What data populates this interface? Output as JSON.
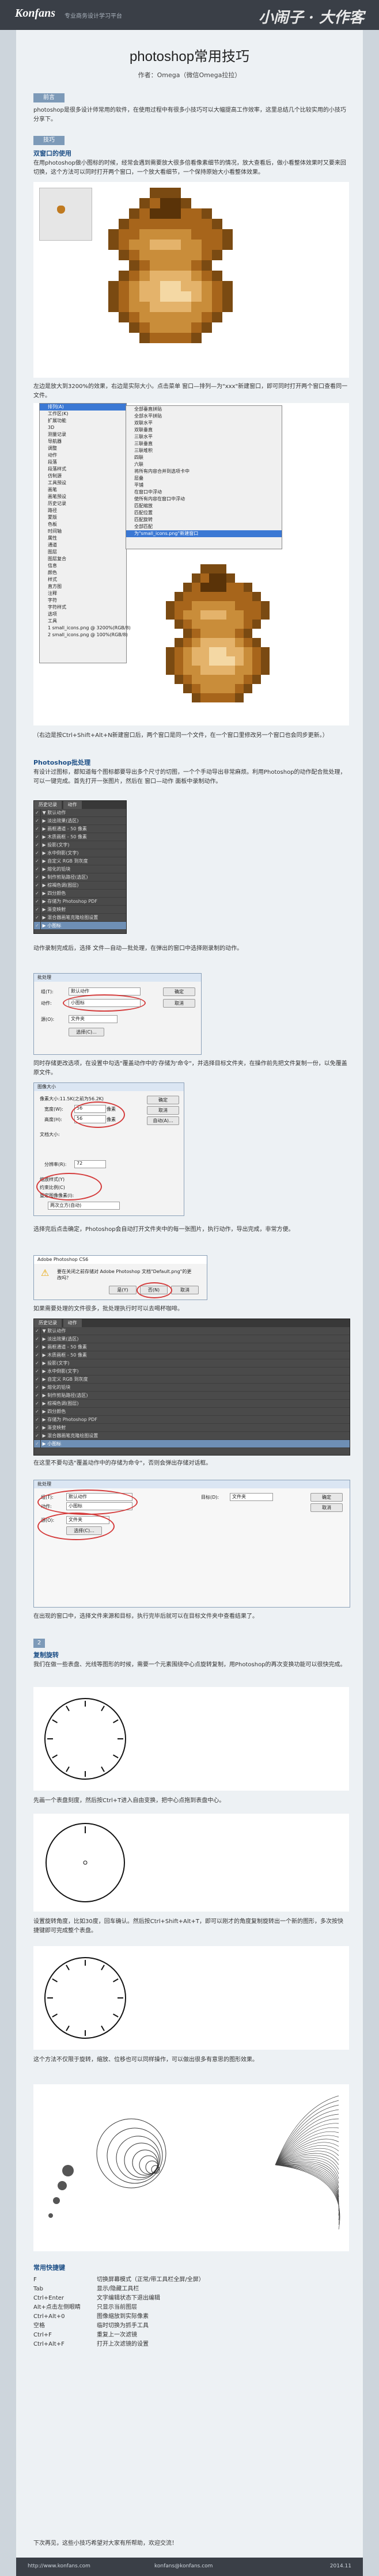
{
  "header": {
    "logo": "Konfans",
    "tagline": "专业商务设计学习平台",
    "signature": "小闹子 · 大作客"
  },
  "title": "photoshop常用技巧",
  "author": "作者：Omega（微信Omega拉拉）",
  "sections": {
    "intro_tag": "前言",
    "intro_text": "photoshop是很多设计师常用的软件，在使用过程中有很多小技巧可以大幅提高工作效率，这里总结几个比较实用的小技巧分享下。",
    "tips_tag": "技巧",
    "tip1_title": "1",
    "tip1_heading": "双窗口的使用",
    "tip1_text": "在用photoshop做小图标的时候，经常会遇到需要放大很多倍看像素细节的情况，放大查看后，做小看整体效果时又要来回切换，这个方法可以同时打开两个窗口，一个放大看细节，一个保持原始大小看整体效果。",
    "tip1_text2": "左边是放大到3200%的效果，右边是实际大小。点击菜单 窗口—排列—为\"xxx\"新建窗口，即可同时打开两个窗口查看同一文件。",
    "tip1_caption": "（右边是按Ctrl+Shift+Alt+N新建窗口后，两个窗口是同一个文件，在一个窗口里修改另一个窗口也会同步更新。）",
    "tip2_heading": "Photoshop批处理",
    "tip2_text": "有设计过图标，都知道每个图标都要导出多个尺寸的切图，一个个手动导出非常麻烦。利用Photoshop的动作配合批处理，可以一键完成。首先打开一张图片，然后在 窗口—动作 面板中录制动作。",
    "tip2_text2": "动作录制完成后，选择 文件—自动—批处理，在弹出的窗口中选择刚录制的动作。",
    "tip2_text3": "同时存储更改选项，在设置中勾选\"覆盖动作中的'存储为'命令\"，并选择目标文件夹，在操作前先把文件复制一份，以免覆盖原文件。",
    "tip2_text4": "选择完后点击确定，Photoshop会自动打开文件夹中的每一张图片，执行动作，导出完成，非常方便。",
    "tip2_text5": "如果需要处理的文件很多，批处理执行时可以去喝杯咖啡。",
    "tip2_text6": "在这里不要勾选\"覆盖动作中的存储为命令\"，否则会弹出存储对话框。",
    "tip2_text7": "在出现的窗口中，选择文件来源和目标，执行完毕后就可以在目标文件夹中查看结果了。",
    "tip3_title": "2",
    "tip3_heading": "复制旋转",
    "tip3_text": "我们在做一些表盘、光线等图形的时候，需要一个元素围绕中心点旋转复制，用Photoshop的再次变换功能可以很快完成。",
    "tip3_text2": "先画一个表盘刻度，然后按Ctrl+T进入自由变换，把中心点拖到表盘中心。",
    "tip3_text3": "设置旋转角度，比如30度，回车确认。然后按Ctrl+Shift+Alt+T，即可以刚才的角度复制旋转出一个新的图形，多次按快捷键即可完成整个表盘。",
    "tip3_text4": "这个方法不仅限于旋转，缩放、位移也可以同样操作，可以做出很多有意思的图形效果。",
    "shortcut_heading": "常用快捷键",
    "shortcuts": [
      [
        "F",
        "切换屏幕模式（正常/带工具栏全屏/全屏）"
      ],
      [
        "Tab",
        "显示/隐藏工具栏"
      ],
      [
        "Ctrl+Enter",
        "文字编辑状态下退出编辑"
      ],
      [
        "Alt+点击左侧眼睛",
        "只显示当前图层"
      ],
      [
        "Ctrl+Alt+0",
        "图像缩放到实际像素"
      ],
      [
        "空格",
        "临时切换为抓手工具"
      ],
      [
        "Ctrl+F",
        "重复上一次滤镜"
      ],
      [
        "Ctrl+Alt+F",
        "打开上次滤镜的设置"
      ]
    ],
    "closing": "下次再见，这些小技巧希望对大家有所帮助，欢迎交流！"
  },
  "menu": {
    "items_left": [
      "排列(A)",
      "工作区(K)",
      "扩展功能",
      "3D",
      "测量记录",
      "导航器",
      "调整",
      "动作",
      "段落",
      "段落样式",
      "仿制源",
      "工具预设",
      "画笔",
      "画笔预设",
      "历史记录",
      "路径",
      "蒙版",
      "色板",
      "时间轴",
      "属性",
      "通道",
      "图层",
      "图层复合",
      "信息",
      "颜色",
      "样式",
      "直方图",
      "注释",
      "字符",
      "字符样式",
      "选项",
      "工具",
      "1 small_icons.png @ 3200%(RGB/8)",
      "2 small_icons.png @ 100%(RGB/8)"
    ],
    "items_right": [
      "全部垂直拼贴",
      "全部水平拼贴",
      "双联水平",
      "双联垂直",
      "三联水平",
      "三联垂直",
      "三联堆积",
      "四联",
      "六联",
      "将所有内容合并到选项卡中",
      "层叠",
      "平铺",
      "在窗口中浮动",
      "使所有内容在窗口中浮动",
      "匹配缩放",
      "匹配位置",
      "匹配旋转",
      "全部匹配",
      "为\"small_icons.png\"新建窗口"
    ]
  },
  "actions_panel": {
    "tabs": [
      "历史记录",
      "动作"
    ],
    "rows": [
      "默认动作",
      "淡出效果(选区)",
      "画框通道 - 50 像素",
      "木质画框 - 50 像素",
      "投影(文字)",
      "水中倒影(文字)",
      "自定义 RGB 到灰度",
      "熔化的铅块",
      "制作剪贴路径(选区)",
      "棕褐色调(图层)",
      "四分颜色",
      "存储为 Photoshop PDF",
      "渐变映射",
      "混合器画笔克隆绘图设置",
      "小图标"
    ]
  },
  "batch_dialog": {
    "title": "批处理",
    "set_label": "组(T):",
    "set_value": "默认动作",
    "action_label": "动作:",
    "action_value": "小图标",
    "source_label": "源(O):",
    "source_value": "文件夹",
    "choose": "选择(C)...",
    "ok": "确定",
    "cancel": "取消",
    "dest_label": "目标(D):",
    "dest_value": "文件夹"
  },
  "size_dialog": {
    "title": "图像大小",
    "pixel_dims": "像素大小:11.5K(之前为56.2K)",
    "width_label": "宽度(W):",
    "width_value": "56",
    "height_label": "高度(H):",
    "height_value": "56",
    "unit": "像素",
    "doc_size": "文档大小:",
    "res_label": "分辨率(R):",
    "res_value": "72",
    "scale_styles": "缩放样式(Y)",
    "constrain": "约束比例(C)",
    "resample": "重定图像像素(I):",
    "resample_value": "两次立方(自动)",
    "ok": "确定",
    "cancel": "取消",
    "auto": "自动(A)..."
  },
  "alert_dialog": {
    "title": "Adobe Photoshop CS6",
    "message": "要在关闭之前存储对 Adobe Photoshop 文档\"Default.png\"的更改吗？",
    "yes": "是(Y)",
    "no": "否(N)",
    "cancel": "取消"
  },
  "footer": {
    "left": "http://www.konfans.com",
    "mid": "konfans@konfans.com",
    "right": "2014.11"
  }
}
